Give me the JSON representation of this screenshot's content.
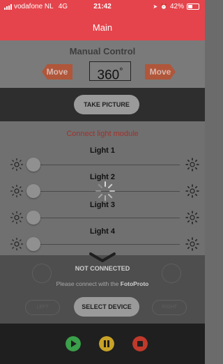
{
  "status_bar": {
    "carrier": "vodafone NL",
    "network": "4G",
    "time": "21:42",
    "battery": "42%",
    "battery_level": 0.42
  },
  "nav": {
    "title": "Main"
  },
  "manual": {
    "label": "Manual Control",
    "move_left": "Move",
    "move_right": "Move",
    "degrees": "360",
    "degree_unit": "°"
  },
  "picture": {
    "button": "TAKE PICTURE"
  },
  "lights": {
    "connect_label": "Connect light module",
    "items": [
      {
        "label": "Light 1",
        "level": 0
      },
      {
        "label": "Light 2",
        "level": 0
      },
      {
        "label": "Light 3",
        "level": 0
      },
      {
        "label": "Light 4",
        "level": 0
      }
    ]
  },
  "overlay": {
    "status": "NOT CONNECTED",
    "message_prefix": "Please connect with the ",
    "message_brand": "FotoProto",
    "button": "SELECT DEVICE",
    "ghost_left": "LEFT",
    "ghost_right": "RIGHT"
  },
  "controls": {
    "play_color": "#3aa04a",
    "pause_color": "#c9a227",
    "stop_color": "#c0392b"
  },
  "colors": {
    "accent": "#e5444c"
  }
}
